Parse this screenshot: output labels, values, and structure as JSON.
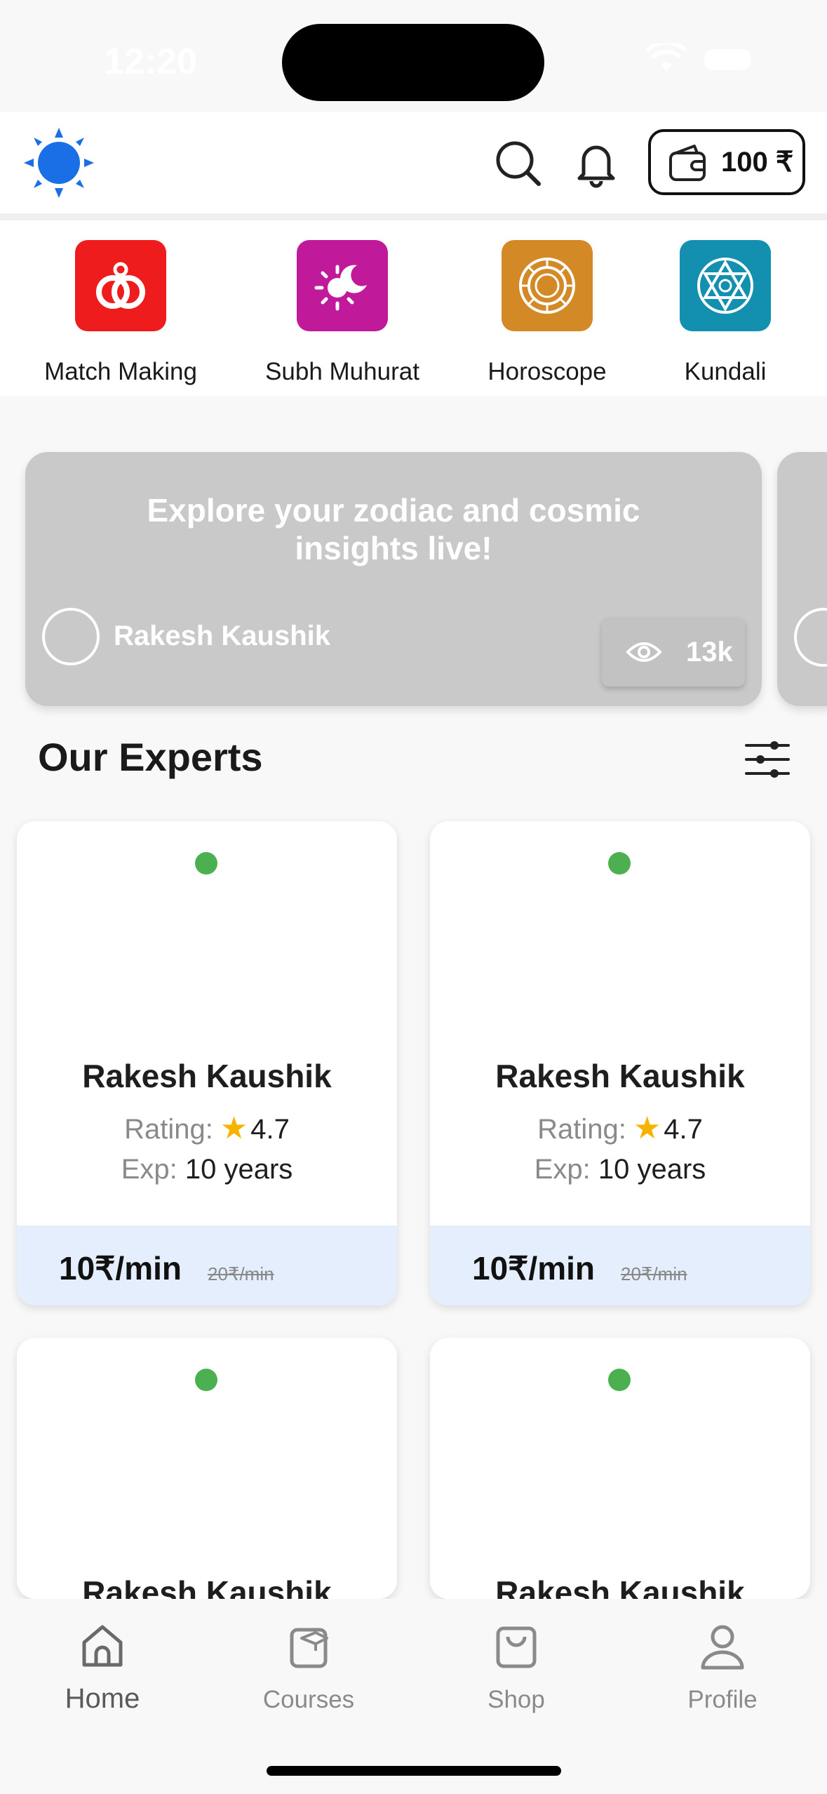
{
  "status_bar": {
    "time": "12:20"
  },
  "header": {
    "logo_icon": "sun-logo-icon",
    "search_icon": "search-icon",
    "notification_icon": "bell-icon",
    "wallet": {
      "icon": "wallet-icon",
      "amount": "100 ₹"
    }
  },
  "services": [
    {
      "label": "Match Making",
      "icon": "rings-icon",
      "color": "#ee1c1c"
    },
    {
      "label": "Subh Muhurat",
      "icon": "sun-moon-icon",
      "color": "#c0199a"
    },
    {
      "label": "Horoscope",
      "icon": "zodiac-wheel-icon",
      "color": "#d38a26"
    },
    {
      "label": "Kundali",
      "icon": "star-of-david-icon",
      "color": "#1390b0"
    }
  ],
  "banner": {
    "title": "Explore your zodiac and cosmic insights live!",
    "host": "Rakesh Kaushik",
    "views": "13k",
    "views_icon": "eye-icon"
  },
  "experts": {
    "title": "Our Experts",
    "filter_icon": "filter-sliders-icon",
    "rating_label": "Rating:",
    "exp_label": "Exp:",
    "items": [
      {
        "name": "Rakesh Kaushik",
        "rating": "4.7",
        "experience": "10 years",
        "price": "10₹/min",
        "old_price": "20₹/min",
        "online": true
      },
      {
        "name": "Rakesh Kaushik",
        "rating": "4.7",
        "experience": "10 years",
        "price": "10₹/min",
        "old_price": "20₹/min",
        "online": true
      },
      {
        "name": "Rakesh Kaushik",
        "online": true
      },
      {
        "name": "Rakesh Kaushik",
        "online": true
      }
    ]
  },
  "bottom_nav": [
    {
      "label": "Home",
      "icon": "home-icon",
      "active": true
    },
    {
      "label": "Courses",
      "icon": "courses-icon",
      "active": false
    },
    {
      "label": "Shop",
      "icon": "shop-bag-icon",
      "active": false
    },
    {
      "label": "Profile",
      "icon": "profile-icon",
      "active": false
    }
  ],
  "colors": {
    "accent": "#1a6fe6",
    "online": "#4caf50",
    "price_bg": "#e4eefc",
    "star": "#f5b400"
  }
}
